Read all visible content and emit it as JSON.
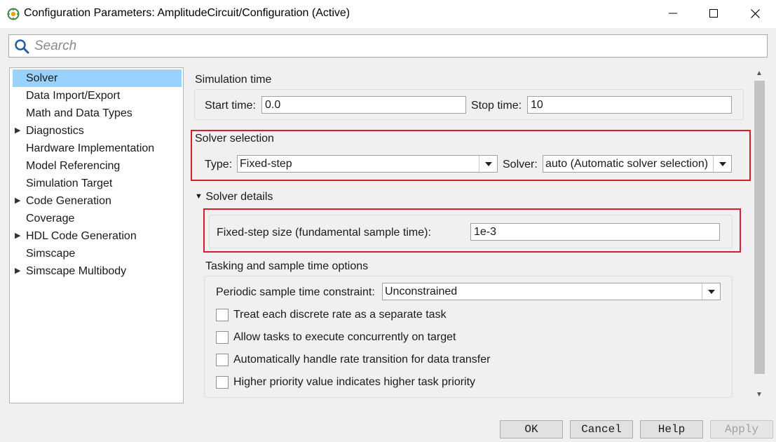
{
  "window": {
    "title": "Configuration Parameters: AmplitudeCircuit/Configuration (Active)"
  },
  "search": {
    "placeholder": "Search"
  },
  "nav": {
    "items": [
      {
        "label": "Solver",
        "expandable": false,
        "selected": true
      },
      {
        "label": "Data Import/Export",
        "expandable": false
      },
      {
        "label": "Math and Data Types",
        "expandable": false
      },
      {
        "label": "Diagnostics",
        "expandable": true
      },
      {
        "label": "Hardware Implementation",
        "expandable": false
      },
      {
        "label": "Model Referencing",
        "expandable": false
      },
      {
        "label": "Simulation Target",
        "expandable": false
      },
      {
        "label": "Code Generation",
        "expandable": true
      },
      {
        "label": "Coverage",
        "expandable": false
      },
      {
        "label": "HDL Code Generation",
        "expandable": true
      },
      {
        "label": "Simscape",
        "expandable": false
      },
      {
        "label": "Simscape Multibody",
        "expandable": true
      }
    ]
  },
  "simulation_time": {
    "heading": "Simulation time",
    "start_label": "Start time:",
    "start_value": "0.0",
    "stop_label": "Stop time:",
    "stop_value": "10"
  },
  "solver_selection": {
    "heading": "Solver selection",
    "type_label": "Type:",
    "type_value": "Fixed-step",
    "solver_label": "Solver:",
    "solver_value": "auto (Automatic solver selection)"
  },
  "solver_details": {
    "heading": "Solver details",
    "step_size_label": "Fixed-step size (fundamental sample time):",
    "step_size_value": "1e-3"
  },
  "tasking": {
    "heading": "Tasking and sample time options",
    "periodic_label": "Periodic sample time constraint:",
    "periodic_value": "Unconstrained",
    "checkboxes": [
      {
        "label": "Treat each discrete rate as a separate task",
        "checked": false
      },
      {
        "label": "Allow tasks to execute concurrently on target",
        "checked": false
      },
      {
        "label": "Automatically handle rate transition for data transfer",
        "checked": false
      },
      {
        "label": "Higher priority value indicates higher task priority",
        "checked": false
      }
    ]
  },
  "footer": {
    "ok": "OK",
    "cancel": "Cancel",
    "help": "Help",
    "apply": "Apply"
  },
  "colors": {
    "selection": "#99d1ff",
    "highlight_box": "#d41e2b"
  },
  "icons": [
    "app-icon",
    "minimize-icon",
    "maximize-icon",
    "close-icon",
    "search-icon",
    "expand-arrow-icon",
    "dropdown-arrow-icon"
  ]
}
